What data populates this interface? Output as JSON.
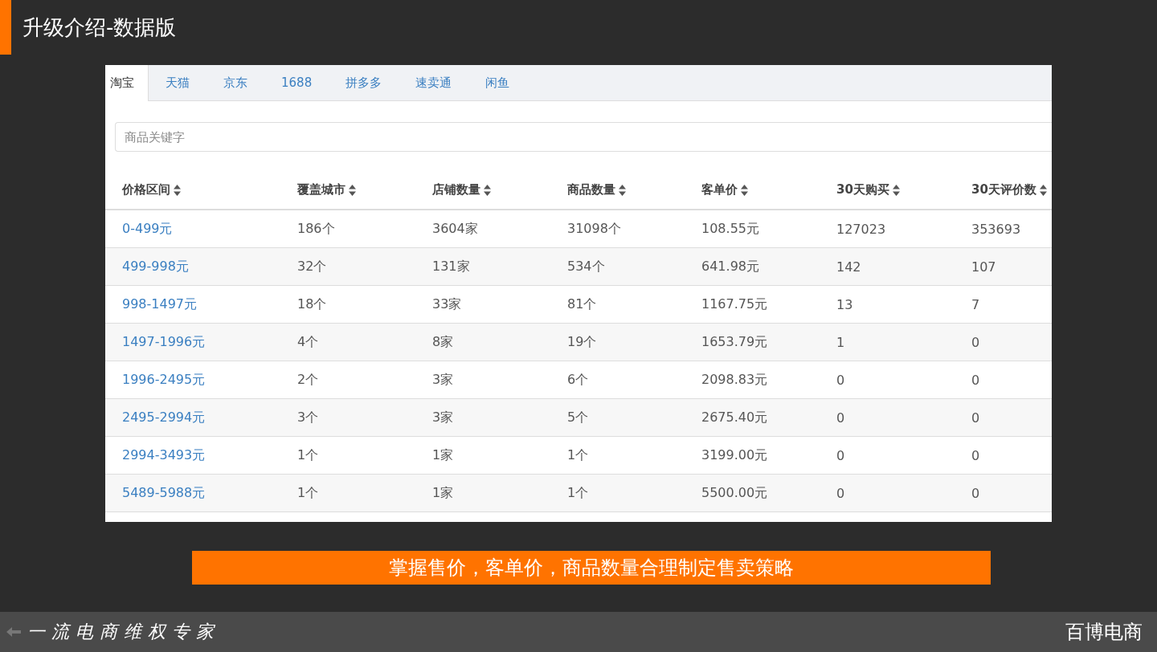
{
  "slide_title": "升级介绍-数据版",
  "tabs": [
    {
      "label": "淘宝",
      "selected": true
    },
    {
      "label": "天猫",
      "selected": false
    },
    {
      "label": "京东",
      "selected": false
    },
    {
      "label": "1688",
      "selected": false
    },
    {
      "label": "拼多多",
      "selected": false
    },
    {
      "label": "速卖通",
      "selected": false
    },
    {
      "label": "闲鱼",
      "selected": false
    }
  ],
  "search": {
    "placeholder": "商品关键字"
  },
  "table": {
    "columns": [
      "价格区间",
      "覆盖城市",
      "店铺数量",
      "商品数量",
      "客单价",
      "30天购买",
      "30天评价数"
    ],
    "rows": [
      [
        "0-499元",
        "186个",
        "3604家",
        "31098个",
        "108.55元",
        "127023",
        "353693"
      ],
      [
        "499-998元",
        "32个",
        "131家",
        "534个",
        "641.98元",
        "142",
        "107"
      ],
      [
        "998-1497元",
        "18个",
        "33家",
        "81个",
        "1167.75元",
        "13",
        "7"
      ],
      [
        "1497-1996元",
        "4个",
        "8家",
        "19个",
        "1653.79元",
        "1",
        "0"
      ],
      [
        "1996-2495元",
        "2个",
        "3家",
        "6个",
        "2098.83元",
        "0",
        "0"
      ],
      [
        "2495-2994元",
        "3个",
        "3家",
        "5个",
        "2675.40元",
        "0",
        "0"
      ],
      [
        "2994-3493元",
        "1个",
        "1家",
        "1个",
        "3199.00元",
        "0",
        "0"
      ],
      [
        "5489-5988元",
        "1个",
        "1家",
        "1个",
        "5500.00元",
        "0",
        "0"
      ]
    ]
  },
  "banner": "掌握售价，客单价，商品数量合理制定售卖策略",
  "footer": {
    "tagline": "一流电商维权专家",
    "brand": "百博电商"
  }
}
